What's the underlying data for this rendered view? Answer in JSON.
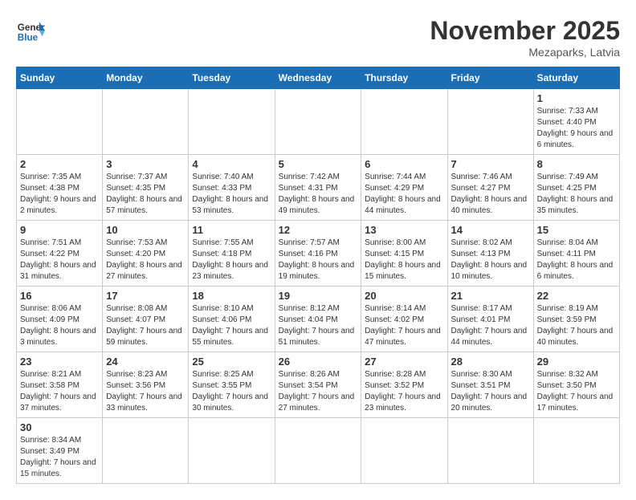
{
  "header": {
    "logo_general": "General",
    "logo_blue": "Blue",
    "month_title": "November 2025",
    "location": "Mezaparks, Latvia"
  },
  "weekdays": [
    "Sunday",
    "Monday",
    "Tuesday",
    "Wednesday",
    "Thursday",
    "Friday",
    "Saturday"
  ],
  "days": {
    "d1": {
      "num": "1",
      "sunrise": "7:33 AM",
      "sunset": "4:40 PM",
      "daylight": "9 hours and 6 minutes."
    },
    "d2": {
      "num": "2",
      "sunrise": "7:35 AM",
      "sunset": "4:38 PM",
      "daylight": "9 hours and 2 minutes."
    },
    "d3": {
      "num": "3",
      "sunrise": "7:37 AM",
      "sunset": "4:35 PM",
      "daylight": "8 hours and 57 minutes."
    },
    "d4": {
      "num": "4",
      "sunrise": "7:40 AM",
      "sunset": "4:33 PM",
      "daylight": "8 hours and 53 minutes."
    },
    "d5": {
      "num": "5",
      "sunrise": "7:42 AM",
      "sunset": "4:31 PM",
      "daylight": "8 hours and 49 minutes."
    },
    "d6": {
      "num": "6",
      "sunrise": "7:44 AM",
      "sunset": "4:29 PM",
      "daylight": "8 hours and 44 minutes."
    },
    "d7": {
      "num": "7",
      "sunrise": "7:46 AM",
      "sunset": "4:27 PM",
      "daylight": "8 hours and 40 minutes."
    },
    "d8": {
      "num": "8",
      "sunrise": "7:49 AM",
      "sunset": "4:25 PM",
      "daylight": "8 hours and 35 minutes."
    },
    "d9": {
      "num": "9",
      "sunrise": "7:51 AM",
      "sunset": "4:22 PM",
      "daylight": "8 hours and 31 minutes."
    },
    "d10": {
      "num": "10",
      "sunrise": "7:53 AM",
      "sunset": "4:20 PM",
      "daylight": "8 hours and 27 minutes."
    },
    "d11": {
      "num": "11",
      "sunrise": "7:55 AM",
      "sunset": "4:18 PM",
      "daylight": "8 hours and 23 minutes."
    },
    "d12": {
      "num": "12",
      "sunrise": "7:57 AM",
      "sunset": "4:16 PM",
      "daylight": "8 hours and 19 minutes."
    },
    "d13": {
      "num": "13",
      "sunrise": "8:00 AM",
      "sunset": "4:15 PM",
      "daylight": "8 hours and 15 minutes."
    },
    "d14": {
      "num": "14",
      "sunrise": "8:02 AM",
      "sunset": "4:13 PM",
      "daylight": "8 hours and 10 minutes."
    },
    "d15": {
      "num": "15",
      "sunrise": "8:04 AM",
      "sunset": "4:11 PM",
      "daylight": "8 hours and 6 minutes."
    },
    "d16": {
      "num": "16",
      "sunrise": "8:06 AM",
      "sunset": "4:09 PM",
      "daylight": "8 hours and 3 minutes."
    },
    "d17": {
      "num": "17",
      "sunrise": "8:08 AM",
      "sunset": "4:07 PM",
      "daylight": "7 hours and 59 minutes."
    },
    "d18": {
      "num": "18",
      "sunrise": "8:10 AM",
      "sunset": "4:06 PM",
      "daylight": "7 hours and 55 minutes."
    },
    "d19": {
      "num": "19",
      "sunrise": "8:12 AM",
      "sunset": "4:04 PM",
      "daylight": "7 hours and 51 minutes."
    },
    "d20": {
      "num": "20",
      "sunrise": "8:14 AM",
      "sunset": "4:02 PM",
      "daylight": "7 hours and 47 minutes."
    },
    "d21": {
      "num": "21",
      "sunrise": "8:17 AM",
      "sunset": "4:01 PM",
      "daylight": "7 hours and 44 minutes."
    },
    "d22": {
      "num": "22",
      "sunrise": "8:19 AM",
      "sunset": "3:59 PM",
      "daylight": "7 hours and 40 minutes."
    },
    "d23": {
      "num": "23",
      "sunrise": "8:21 AM",
      "sunset": "3:58 PM",
      "daylight": "7 hours and 37 minutes."
    },
    "d24": {
      "num": "24",
      "sunrise": "8:23 AM",
      "sunset": "3:56 PM",
      "daylight": "7 hours and 33 minutes."
    },
    "d25": {
      "num": "25",
      "sunrise": "8:25 AM",
      "sunset": "3:55 PM",
      "daylight": "7 hours and 30 minutes."
    },
    "d26": {
      "num": "26",
      "sunrise": "8:26 AM",
      "sunset": "3:54 PM",
      "daylight": "7 hours and 27 minutes."
    },
    "d27": {
      "num": "27",
      "sunrise": "8:28 AM",
      "sunset": "3:52 PM",
      "daylight": "7 hours and 23 minutes."
    },
    "d28": {
      "num": "28",
      "sunrise": "8:30 AM",
      "sunset": "3:51 PM",
      "daylight": "7 hours and 20 minutes."
    },
    "d29": {
      "num": "29",
      "sunrise": "8:32 AM",
      "sunset": "3:50 PM",
      "daylight": "7 hours and 17 minutes."
    },
    "d30": {
      "num": "30",
      "sunrise": "8:34 AM",
      "sunset": "3:49 PM",
      "daylight": "7 hours and 15 minutes."
    }
  }
}
